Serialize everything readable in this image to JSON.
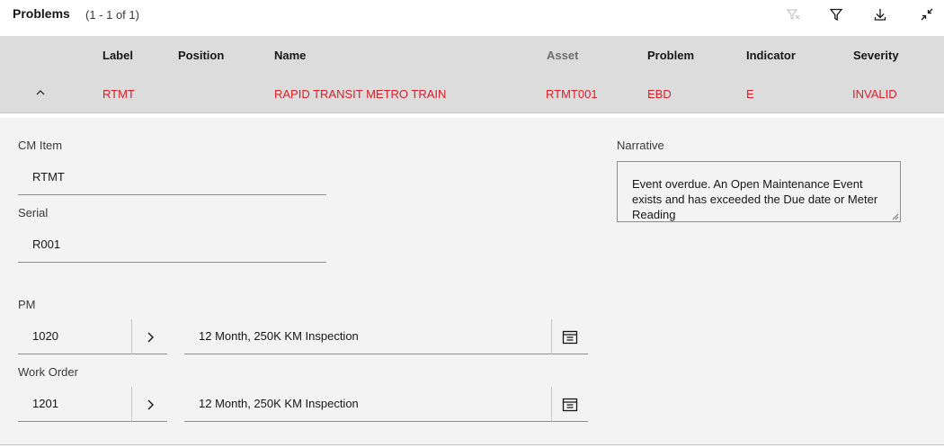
{
  "header": {
    "title": "Problems",
    "count": "(1 - 1 of 1)",
    "tools": [
      "clear-filter-icon",
      "filter-icon",
      "download-icon",
      "collapse-icon"
    ]
  },
  "table": {
    "columns": [
      "Label",
      "Position",
      "Name",
      "Asset",
      "Problem",
      "Indicator",
      "Severity"
    ],
    "row": {
      "label": "RTMT",
      "position": "",
      "name": "RAPID TRANSIT METRO TRAIN",
      "asset": "RTMT001",
      "problem": "EBD",
      "indicator": "E",
      "severity": "INVALID"
    }
  },
  "detail": {
    "cm_item_label": "CM Item",
    "cm_item_value": "RTMT",
    "serial_label": "Serial",
    "serial_value": "R001",
    "pm_label": "PM",
    "pm_value": "1020",
    "pm_desc": "12 Month, 250K KM Inspection",
    "wo_label": "Work Order",
    "wo_value": "1201",
    "wo_desc": "12 Month, 250K KM Inspection",
    "narrative_label": "Narrative",
    "narrative_text": "Event overdue. An Open Maintenance Event exists and has exceeded the Due date or Meter Reading"
  },
  "colors": {
    "accent_red": "#da1e28",
    "header_gray": "#dcdcdc",
    "panel_gray": "#f3f3f3"
  }
}
